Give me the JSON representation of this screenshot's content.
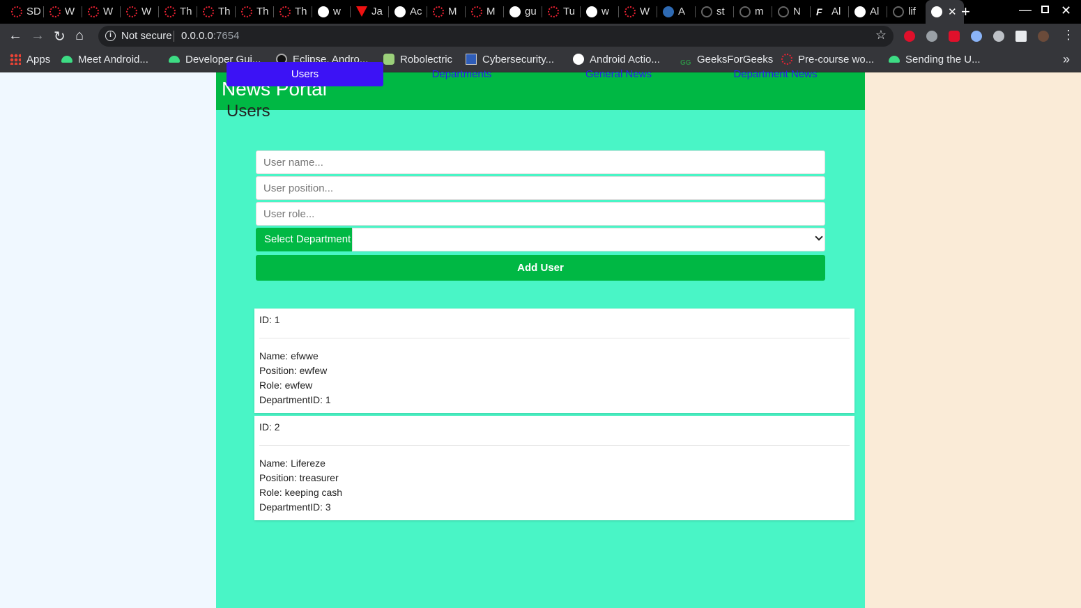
{
  "browser": {
    "tabs": [
      {
        "icon": "opera-red-icon",
        "text": "SD"
      },
      {
        "icon": "opera-red-icon",
        "text": "W"
      },
      {
        "icon": "opera-red-icon",
        "text": "W"
      },
      {
        "icon": "opera-red-icon",
        "text": "W"
      },
      {
        "icon": "opera-red-icon",
        "text": "Th"
      },
      {
        "icon": "opera-red-icon",
        "text": "Th"
      },
      {
        "icon": "opera-red-icon",
        "text": "Th"
      },
      {
        "icon": "opera-red-icon",
        "text": "Th"
      },
      {
        "icon": "globe-icon",
        "text": "w"
      },
      {
        "icon": "triangle-red-icon",
        "text": "Ja"
      },
      {
        "icon": "globe-icon",
        "text": "Ac"
      },
      {
        "icon": "opera-red-icon",
        "text": "M"
      },
      {
        "icon": "opera-red-icon",
        "text": "M"
      },
      {
        "icon": "globe-icon",
        "text": "gu"
      },
      {
        "icon": "opera-red-icon",
        "text": "Tu"
      },
      {
        "icon": "globe-icon",
        "text": "w"
      },
      {
        "icon": "opera-red-icon",
        "text": "W"
      },
      {
        "icon": "blue-circle-icon",
        "text": "A"
      },
      {
        "icon": "github-icon",
        "text": "st"
      },
      {
        "icon": "github-icon",
        "text": "m"
      },
      {
        "icon": "github-icon",
        "text": "N"
      },
      {
        "icon": "f-icon",
        "text": "Al"
      },
      {
        "icon": "globe-icon",
        "text": "Al"
      },
      {
        "icon": "github-icon",
        "text": "lif"
      }
    ],
    "active_tab": {
      "icon": "globe-icon",
      "close": "✕"
    },
    "new_tab": "+",
    "address": {
      "security": "Not secure",
      "host": "0.0.0.0",
      "port": ":7654"
    },
    "bookmarks": [
      {
        "icon": "apps-icon",
        "label": "Apps"
      },
      {
        "icon": "android-icon",
        "label": "Meet Android..."
      },
      {
        "icon": "android-icon",
        "label": "Developer Gui..."
      },
      {
        "icon": "eclipse-icon",
        "label": "Eclipse, Andro..."
      },
      {
        "icon": "robolectric-icon",
        "label": "Robolectric"
      },
      {
        "icon": "cyber-icon",
        "label": "Cybersecurity..."
      },
      {
        "icon": "globe-icon",
        "label": "Android Actio..."
      },
      {
        "icon": "gfg-icon",
        "label": "GeeksForGeeks"
      },
      {
        "icon": "opera-red-icon",
        "label": "Pre-course wo..."
      },
      {
        "icon": "android-icon",
        "label": "Sending the U..."
      }
    ],
    "bookmarks_more": "»"
  },
  "site": {
    "title": "News Portal"
  },
  "nav": [
    {
      "label": "Users",
      "active": true
    },
    {
      "label": "Departments",
      "active": false
    },
    {
      "label": "General News",
      "active": false
    },
    {
      "label": "Department News",
      "active": false
    }
  ],
  "section_title": "Users",
  "form": {
    "name_placeholder": "User name...",
    "position_placeholder": "User position...",
    "role_placeholder": "User role...",
    "department_label": "Select Department",
    "department_value": "",
    "submit_label": "Add User"
  },
  "users": [
    {
      "id": "ID: 1",
      "name": "Name: efwwe",
      "position": "Position: ewfew",
      "role": "Role: ewfew",
      "department": "DepartmentID: 1"
    },
    {
      "id": "ID: 2",
      "name": "Name: Lifereze",
      "position": "Position: treasurer",
      "role": "Role: keeping cash",
      "department": "DepartmentID: 3"
    }
  ],
  "colors": {
    "header": "#00b844",
    "content_bg": "#49f5c6",
    "active_nav": "#3c12f5",
    "nav_link": "#2b1de8",
    "left_bg": "#f0f8ff",
    "right_bg": "#faebd7"
  }
}
